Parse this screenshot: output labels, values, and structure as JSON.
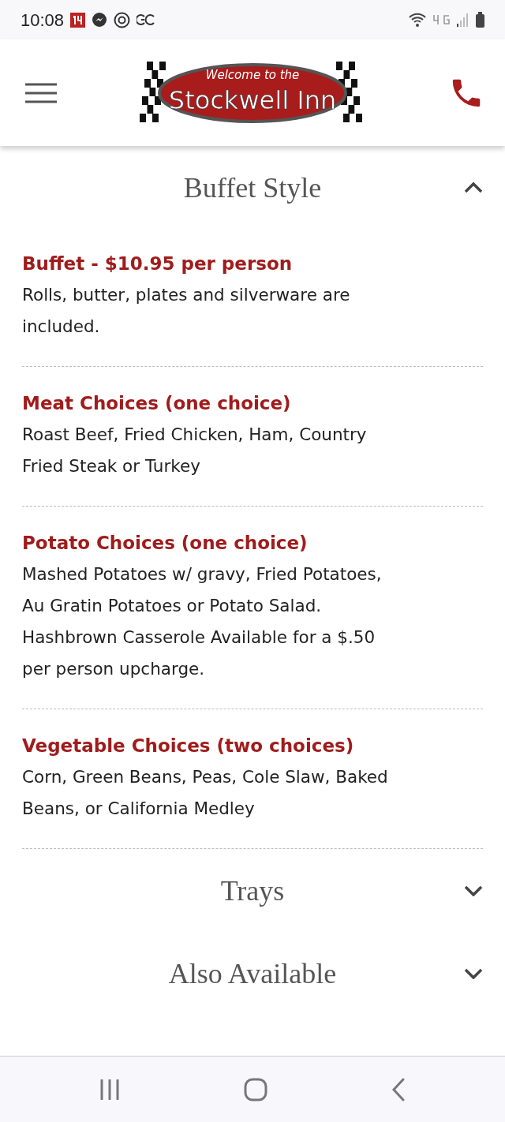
{
  "status_bar": {
    "time": "10:08"
  },
  "header": {
    "logo": {
      "tagline": "Welcome to the",
      "name": "Stockwell Inn"
    }
  },
  "sections": [
    {
      "title": "Buffet Style",
      "expanded": true,
      "items": [
        {
          "heading": "Buffet - $10.95 per person",
          "body": "Rolls, butter, plates and silverware are included."
        },
        {
          "heading": "Meat Choices (one choice)",
          "body": "Roast Beef, Fried Chicken, Ham, Country Fried Steak or Turkey"
        },
        {
          "heading": "Potato Choices (one choice)",
          "body": "Mashed Potatoes w/ gravy, Fried Potatoes, Au Gratin Potatoes or Potato Salad. Hashbrown Casserole Available for a $.50 per person upcharge."
        },
        {
          "heading": "Vegetable Choices (two choices)",
          "body": "Corn, Green Beans, Peas, Cole Slaw, Baked Beans, or California Medley"
        }
      ]
    },
    {
      "title": "Trays",
      "expanded": false
    },
    {
      "title": "Also Available",
      "expanded": false
    }
  ]
}
